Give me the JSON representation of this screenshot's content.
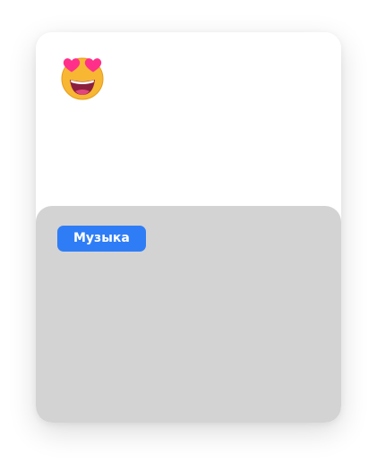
{
  "card": {
    "emoji_icon": "smiling-face-with-heart-eyes-icon",
    "tag_label": "Музыка"
  },
  "colors": {
    "tag_background": "#2f7df6",
    "tag_text": "#ffffff",
    "lower_panel": "#d3d3d3",
    "card_background": "#ffffff"
  }
}
